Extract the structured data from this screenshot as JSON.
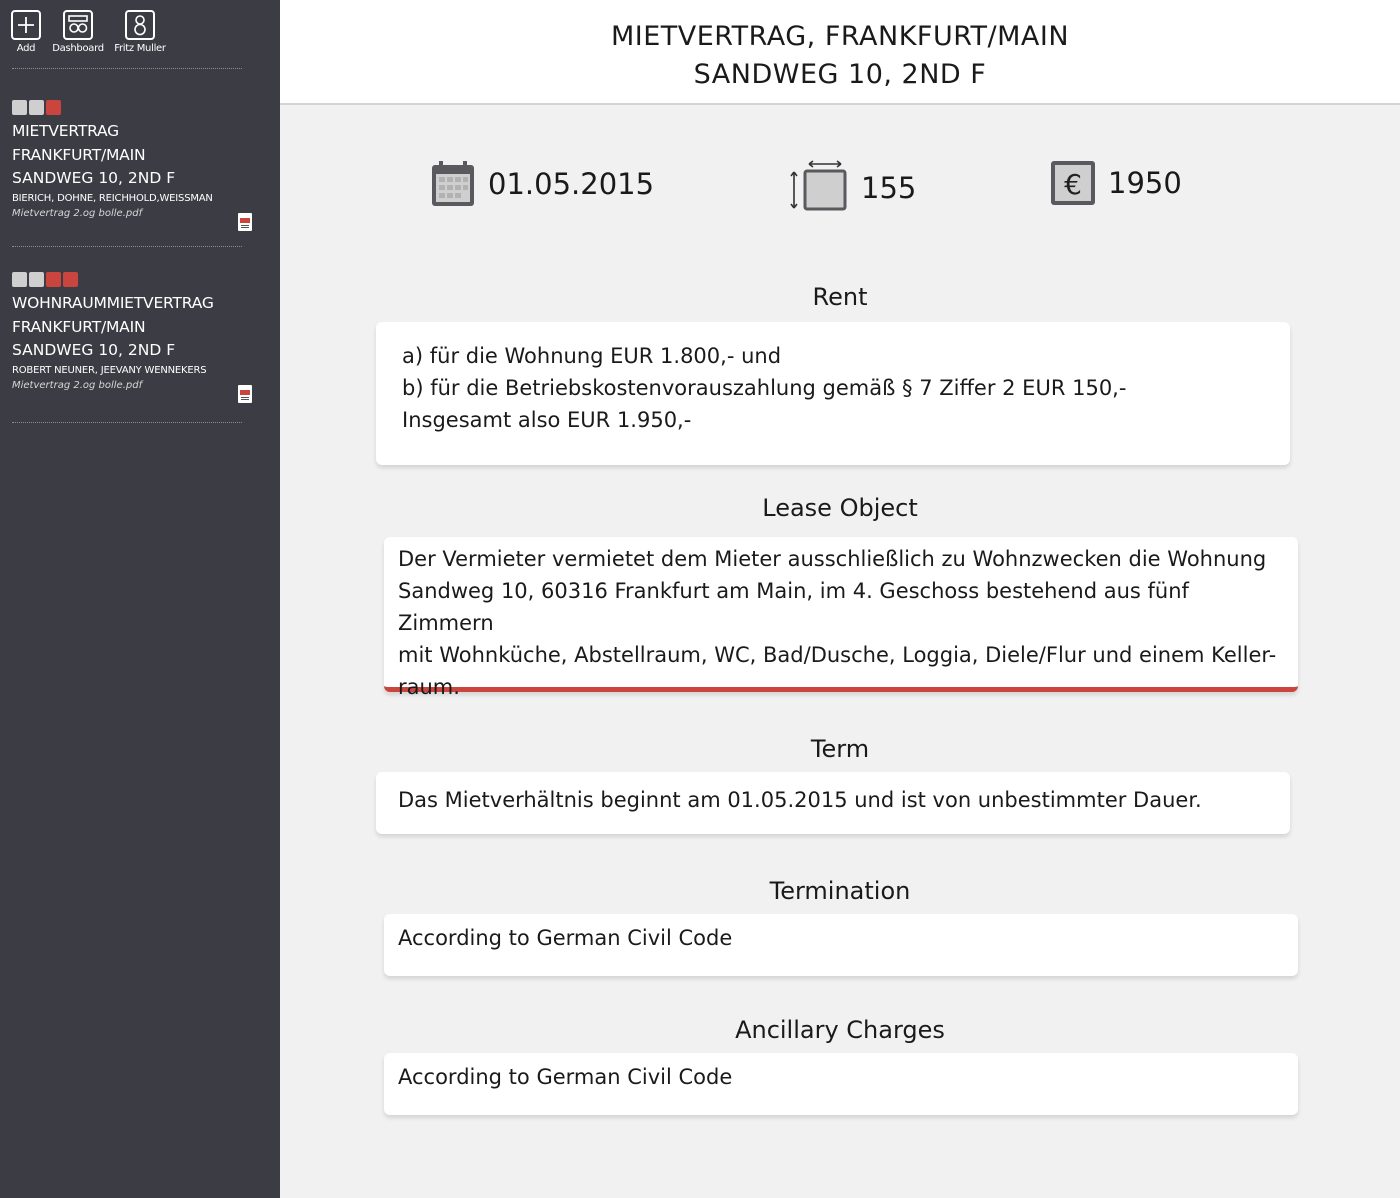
{
  "toolbar": {
    "add_label": "Add",
    "dashboard_label": "Dashboard",
    "user_label": "Fritz Muller"
  },
  "contracts": [
    {
      "title_line1": "Mietvertrag",
      "title_line2": "Frankfurt/Main",
      "address": "Sandweg 10, 2nd F",
      "people": "Bierich, Dohne, Reichhold,Weissman",
      "file": "Mietvertrag 2.og bolle.pdf",
      "status": [
        "gray",
        "gray",
        "red"
      ]
    },
    {
      "title_line1": "Wohnraummietvertrag",
      "title_line2": "Frankfurt/Main",
      "address": "Sandweg 10, 2nd F",
      "people": "Robert Neuner, Jeevany Wennekers",
      "file": "Mietvertrag 2.og bolle.pdf",
      "status": [
        "gray",
        "gray",
        "red",
        "red"
      ]
    }
  ],
  "header": {
    "line1": "MIETVERTRAG, FRANKFURT/MAIN",
    "line2": "SANDWEG 10, 2ND F"
  },
  "stats": {
    "start_date": "01.05.2015",
    "size": "155",
    "rent": "1950"
  },
  "sections": {
    "rent": {
      "title": "Rent",
      "lines": [
        "a) für die Wohnung EUR 1.800,- und",
        "b) für die Betriebskostenvorauszahlung gemäß § 7 Ziffer 2 EUR 150,-",
        "Insgesamt also EUR 1.950,-"
      ]
    },
    "lease_object": {
      "title": "Lease Object",
      "lines": [
        "Der Vermieter vermietet dem Mieter ausschließlich zu Wohnzwecken die Wohnung",
        "Sandweg 10, 60316 Frankfurt am Main, im 4. Geschoss bestehend aus fünf Zimmern",
        "mit Wohnküche, Abstellraum, WC, Bad/Dusche, Loggia, Diele/Flur und einem Keller-",
        "raum."
      ]
    },
    "term": {
      "title": "Term",
      "text": "Das Mietverhältnis beginnt am 01.05.2015 und ist von unbestimmter Dauer."
    },
    "termination": {
      "title": "Termination",
      "text": "According to German Civil Code"
    },
    "ancillary": {
      "title": "Ancillary Charges",
      "text": "According to German Civil Code"
    }
  },
  "colors": {
    "sidebar_bg": "#3c3d44",
    "accent_red": "#c9453d",
    "status_gray": "#cfcfcf"
  },
  "icons": {
    "add": "plus-square-icon",
    "dashboard": "dashboard-icon",
    "user": "user-icon",
    "date": "calendar-icon",
    "size": "area-icon",
    "rent": "euro-icon",
    "file": "pdf-icon"
  }
}
